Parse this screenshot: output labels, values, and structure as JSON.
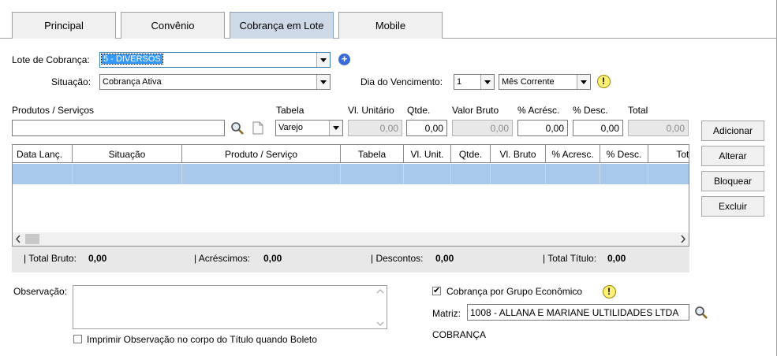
{
  "tabs": [
    "Principal",
    "Convênio",
    "Cobrança em Lote",
    "Mobile"
  ],
  "lote": {
    "label": "Lote de Cobrança:",
    "value": "5 - DIVERSOS"
  },
  "situacao": {
    "label": "Situação:",
    "value": "Cobrança Ativa"
  },
  "vencimento": {
    "label": "Dia do Vencimento:",
    "day": "1",
    "period": "Mês Corrente"
  },
  "form": {
    "produtos_label": "Produtos / Serviços",
    "tabela_label": "Tabela",
    "tabela_value": "Varejo",
    "vl_unitario_label": "Vl. Unitário",
    "vl_unitario_value": "0,00",
    "qtde_label": "Qtde.",
    "qtde_value": "0,00",
    "valor_bruto_label": "Valor Bruto",
    "valor_bruto_value": "0,00",
    "acresc_label": "% Acrésc.",
    "acresc_value": "0,00",
    "desc_label": "% Desc.",
    "desc_value": "0,00",
    "total_label": "Total",
    "total_value": "0,00"
  },
  "buttons": {
    "adicionar": "Adicionar",
    "alterar": "Alterar",
    "bloquear": "Bloquear",
    "excluir": "Excluir"
  },
  "grid": {
    "columns": [
      "Data Lanç.",
      "Situação",
      "Produto / Serviço",
      "Tabela",
      "Vl. Unit.",
      "Qtde.",
      "Vl. Bruto",
      "% Acresc.",
      "% Desc.",
      "Tota"
    ]
  },
  "totals": {
    "bruto_label": "| Total Bruto:",
    "bruto_value": "0,00",
    "acrescimos_label": "| Acréscimos:",
    "acrescimos_value": "0,00",
    "descontos_label": "| Descontos:",
    "descontos_value": "0,00",
    "titulo_label": "| Total Título:",
    "titulo_value": "0,00"
  },
  "observacao": {
    "label": "Observação:",
    "imprimir_label": "Imprimir Observação no corpo do Título quando Boleto"
  },
  "grupo": {
    "label": "Cobrança por Grupo Econômico",
    "checked": true
  },
  "matriz": {
    "label": "Matriz:",
    "value": "1008 - ALLANA E MARIANE ULTILIDADES LTDA"
  },
  "cobranca_text": "COBRANÇA"
}
